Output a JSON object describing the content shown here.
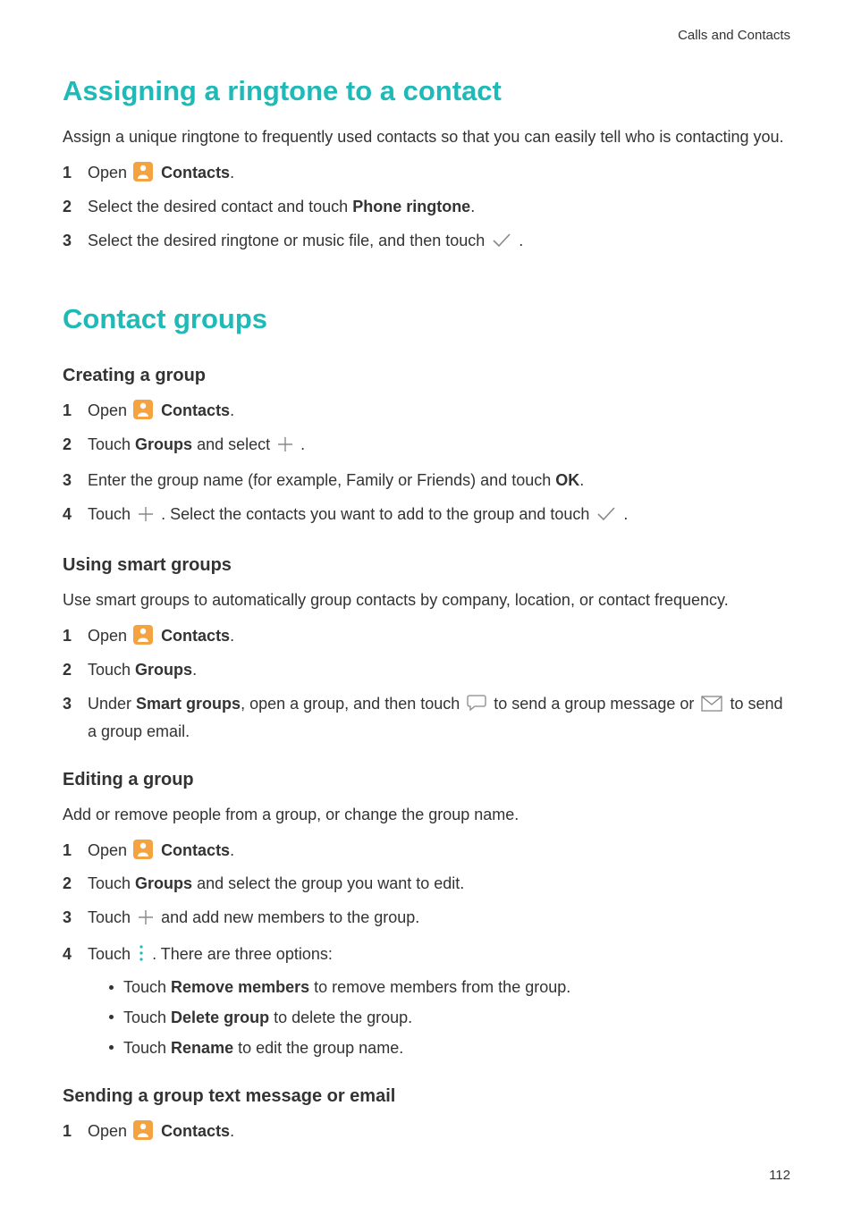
{
  "header": {
    "section_path": "Calls and Contacts"
  },
  "page_number": "112",
  "icons": {
    "contacts_app": "contacts-app-icon",
    "checkmark": "checkmark-icon",
    "plus": "plus-icon",
    "speech": "speech-bubble-icon",
    "envelope": "envelope-icon",
    "more": "more-menu-icon"
  },
  "s1": {
    "title": "Assigning a ringtone to a contact",
    "intro": "Assign a unique ringtone to frequently used contacts so that you can easily tell who is contacting you.",
    "step1_a": "Open ",
    "step1_b": "Contacts",
    "step1_c": ".",
    "step2_a": "Select the desired contact and touch ",
    "step2_b": "Phone ringtone",
    "step2_c": ".",
    "step3_a": "Select the desired ringtone or music file, and then touch ",
    "step3_b": "."
  },
  "s2": {
    "title": "Contact groups",
    "g1": {
      "heading": "Creating a group",
      "step1_a": "Open ",
      "step1_b": "Contacts",
      "step1_c": ".",
      "step2_a": "Touch ",
      "step2_b": "Groups",
      "step2_c": " and select ",
      "step2_d": ".",
      "step3_a": "Enter the group name (for example, Family or Friends) and touch ",
      "step3_b": "OK",
      "step3_c": ".",
      "step4_a": "Touch ",
      "step4_b": ". Select the contacts you want to add to the group and touch ",
      "step4_c": "."
    },
    "g2": {
      "heading": "Using smart groups",
      "intro": "Use smart groups to automatically group contacts by company, location, or contact frequency.",
      "step1_a": "Open ",
      "step1_b": "Contacts",
      "step1_c": ".",
      "step2_a": "Touch ",
      "step2_b": "Groups",
      "step2_c": ".",
      "step3_a": "Under ",
      "step3_b": "Smart groups",
      "step3_c": ", open a group, and then touch ",
      "step3_d": " to send a group message or ",
      "step3_e": " to send a group email."
    },
    "g3": {
      "heading": "Editing a group",
      "intro": "Add or remove people from a group, or change the group name.",
      "step1_a": "Open ",
      "step1_b": "Contacts",
      "step1_c": ".",
      "step2_a": "Touch ",
      "step2_b": "Groups",
      "step2_c": " and select the group you want to edit.",
      "step3_a": "Touch ",
      "step3_b": " and add new members to the group.",
      "step4_a": "Touch ",
      "step4_b": ". There are three options:",
      "bul1_a": "Touch ",
      "bul1_b": "Remove members",
      "bul1_c": " to remove members from the group.",
      "bul2_a": "Touch ",
      "bul2_b": "Delete group",
      "bul2_c": " to delete the group.",
      "bul3_a": "Touch ",
      "bul3_b": "Rename",
      "bul3_c": " to edit the group name."
    },
    "g4": {
      "heading": "Sending a group text message or email",
      "step1_a": "Open ",
      "step1_b": "Contacts",
      "step1_c": "."
    }
  }
}
